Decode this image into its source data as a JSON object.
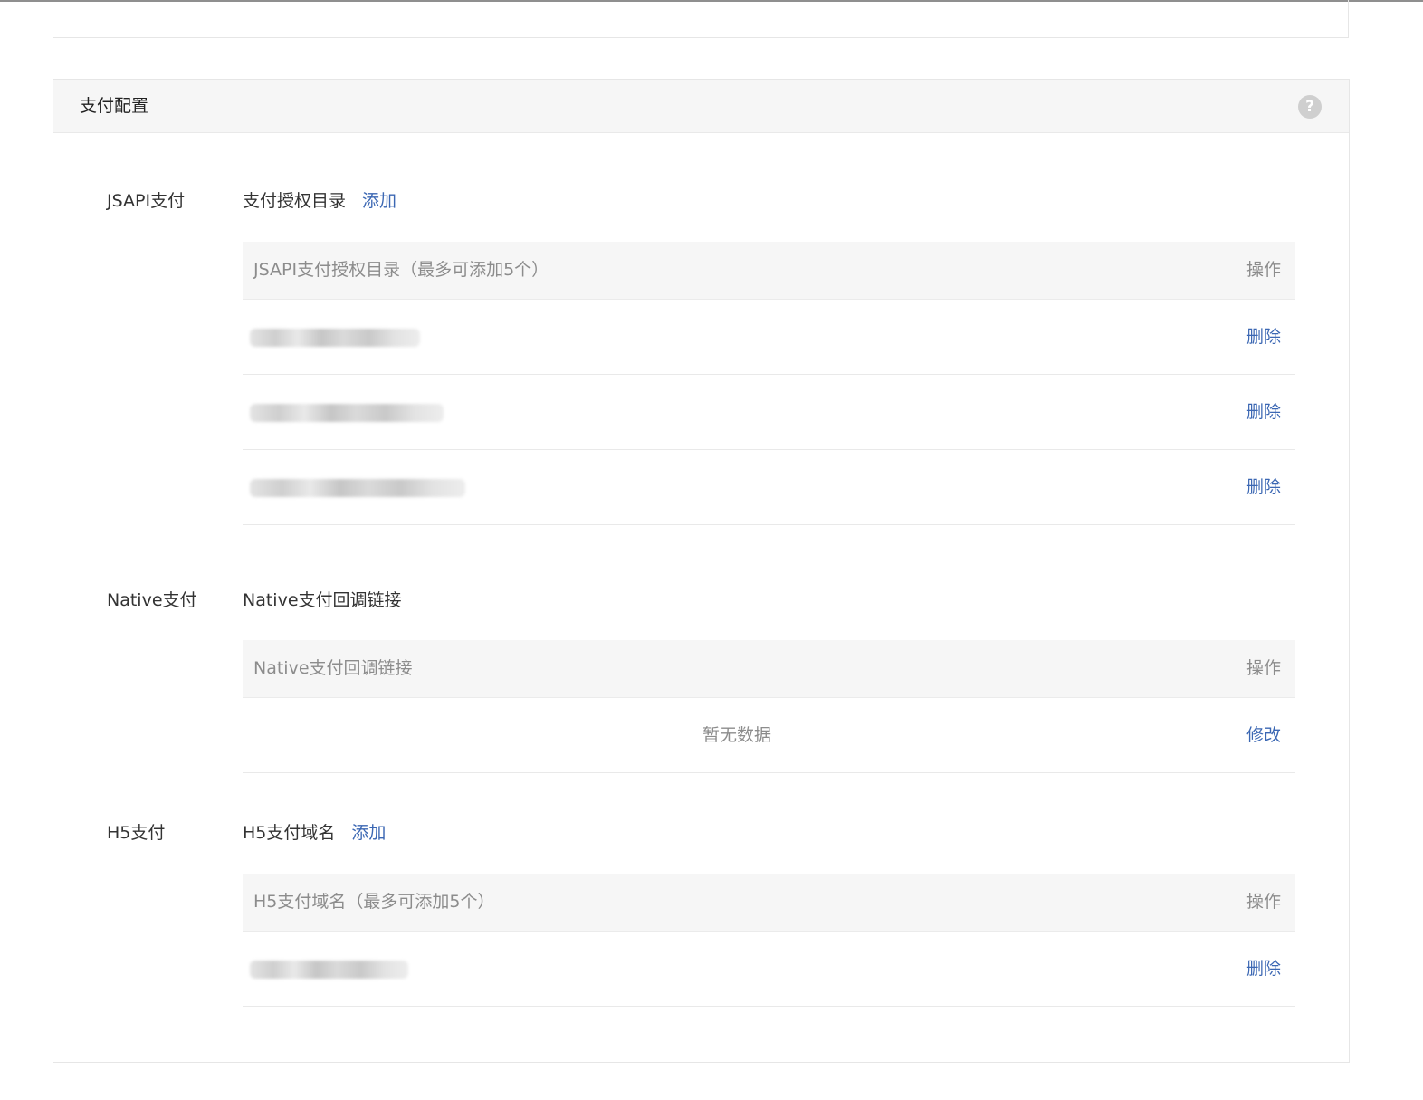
{
  "card": {
    "title": "支付配置"
  },
  "jsapi": {
    "label": "JSAPI支付",
    "sub_label": "支付授权目录",
    "add_link": "添加",
    "table_header": "JSAPI支付授权目录（最多可添加5个）",
    "action_header": "操作",
    "rows": [
      {
        "value": "",
        "action": "删除"
      },
      {
        "value": "",
        "action": "删除"
      },
      {
        "value": "",
        "action": "删除"
      }
    ]
  },
  "native": {
    "label": "Native支付",
    "sub_label": "Native支付回调链接",
    "table_header": "Native支付回调链接",
    "action_header": "操作",
    "empty_text": "暂无数据",
    "row_action": "修改"
  },
  "h5": {
    "label": "H5支付",
    "sub_label": "H5支付域名",
    "add_link": "添加",
    "table_header": "H5支付域名（最多可添加5个）",
    "action_header": "操作",
    "rows": [
      {
        "value": "",
        "action": "删除"
      }
    ]
  },
  "icons": {
    "help": "help-icon"
  }
}
